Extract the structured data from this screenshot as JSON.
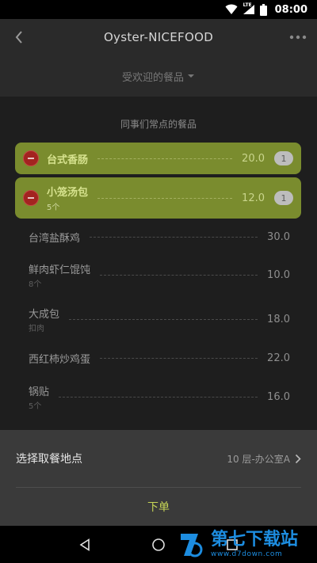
{
  "status_bar": {
    "time": "08:00",
    "network_label": "LTE"
  },
  "app_bar": {
    "title": "Oyster-NICEFOOD"
  },
  "filter": {
    "label": "受欢迎的餐品"
  },
  "section_title": "同事们常点的餐品",
  "selected_items": [
    {
      "name": "台式香肠",
      "sub": "",
      "price": "20.0",
      "qty": "1"
    },
    {
      "name": "小笼汤包",
      "sub": "5个",
      "price": "12.0",
      "qty": "1"
    }
  ],
  "items": [
    {
      "name": "台湾盐酥鸡",
      "sub": "",
      "price": "30.0"
    },
    {
      "name": "鲜肉虾仁馄饨",
      "sub": "8个",
      "price": "10.0"
    },
    {
      "name": "大成包",
      "sub": "扣肉",
      "price": "18.0"
    },
    {
      "name": "西红柿炒鸡蛋",
      "sub": "",
      "price": "22.0"
    },
    {
      "name": "锅贴",
      "sub": "5个",
      "price": "16.0"
    }
  ],
  "pickup": {
    "label": "选择取餐地点",
    "value": "10 层-办公室A"
  },
  "order_button": "下单",
  "watermark": {
    "main": "第七下载站",
    "url": "www.d7down.com"
  },
  "colors": {
    "accent": "#c5d456",
    "selected_bg": "#7a8c2e",
    "remove": "#a32320",
    "watermark": "#1d8de0"
  }
}
